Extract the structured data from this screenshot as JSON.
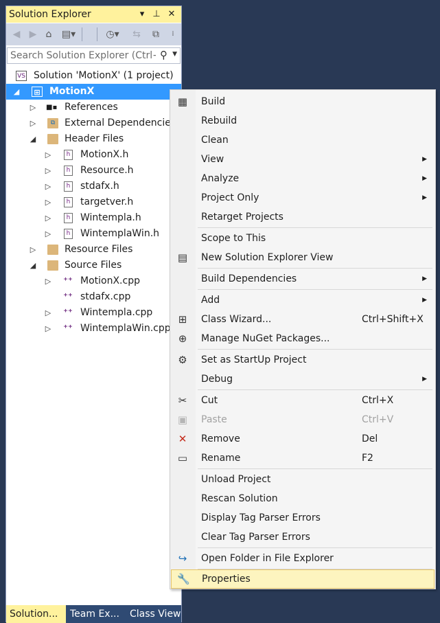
{
  "panel": {
    "title": "Solution Explorer",
    "title_controls": {
      "dropdown": "▾",
      "pin": "⊥",
      "close": "✕"
    },
    "search_placeholder": "Search Solution Explorer (Ctrl+;)",
    "colors": {
      "title_bg": "#fff29d",
      "selection": "#3399ff",
      "toolbar": "#cfd6e5",
      "background": "#293955"
    }
  },
  "tree": [
    {
      "label": "Solution 'MotionX' (1 project)",
      "icon": "solution-icon",
      "expander": ""
    },
    {
      "label": "MotionX",
      "icon": "project-icon",
      "expander": "◢",
      "selected": true
    },
    {
      "label": "References",
      "icon": "references-icon",
      "expander": "▷"
    },
    {
      "label": "External Dependencies",
      "icon": "external-deps-icon",
      "expander": "▷"
    },
    {
      "label": "Header Files",
      "icon": "folder-icon",
      "expander": "◢"
    },
    {
      "label": "MotionX.h",
      "icon": "header-file-icon",
      "expander": "▷"
    },
    {
      "label": "Resource.h",
      "icon": "header-file-icon",
      "expander": "▷"
    },
    {
      "label": "stdafx.h",
      "icon": "header-file-icon",
      "expander": "▷"
    },
    {
      "label": "targetver.h",
      "icon": "header-file-icon",
      "expander": "▷"
    },
    {
      "label": "Wintempla.h",
      "icon": "header-file-icon",
      "expander": "▷"
    },
    {
      "label": "WintemplaWin.h",
      "icon": "header-file-icon",
      "expander": "▷"
    },
    {
      "label": "Resource Files",
      "icon": "folder-icon",
      "expander": "▷"
    },
    {
      "label": "Source Files",
      "icon": "folder-icon",
      "expander": "◢"
    },
    {
      "label": "MotionX.cpp",
      "icon": "cpp-file-icon",
      "expander": "▷"
    },
    {
      "label": "stdafx.cpp",
      "icon": "cpp-file-icon",
      "expander": ""
    },
    {
      "label": "Wintempla.cpp",
      "icon": "cpp-file-icon",
      "expander": "▷"
    },
    {
      "label": "WintemplaWin.cpp",
      "icon": "cpp-file-icon",
      "expander": "▷"
    }
  ],
  "bottom_tabs": [
    {
      "label": "Solution...",
      "active": true
    },
    {
      "label": "Team Ex...",
      "active": false
    },
    {
      "label": "Class View",
      "active": false
    }
  ],
  "context_menu": {
    "items": [
      {
        "label": "Build",
        "icon": "build-icon",
        "glyph": "▦"
      },
      {
        "label": "Rebuild"
      },
      {
        "label": "Clean"
      },
      {
        "label": "View",
        "submenu": true
      },
      {
        "label": "Analyze",
        "submenu": true
      },
      {
        "label": "Project Only",
        "submenu": true
      },
      {
        "label": "Retarget Projects"
      },
      {
        "label": "Scope to This"
      },
      {
        "label": "New Solution Explorer View",
        "icon": "new-view-icon",
        "glyph": "▤"
      },
      {
        "label": "Build Dependencies",
        "submenu": true
      },
      {
        "label": "Add",
        "submenu": true
      },
      {
        "label": "Class Wizard...",
        "shortcut": "Ctrl+Shift+X",
        "icon": "class-wizard-icon",
        "glyph": "⊞"
      },
      {
        "label": "Manage NuGet Packages...",
        "icon": "nuget-icon",
        "glyph": "⊕"
      },
      {
        "label": "Set as StartUp Project",
        "icon": "gear-icon",
        "glyph": "⚙"
      },
      {
        "label": "Debug",
        "submenu": true
      },
      {
        "label": "Cut",
        "shortcut": "Ctrl+X",
        "icon": "scissors-icon",
        "glyph": "✂"
      },
      {
        "label": "Paste",
        "shortcut": "Ctrl+V",
        "icon": "paste-icon",
        "glyph": "▣",
        "disabled": true
      },
      {
        "label": "Remove",
        "shortcut": "Del",
        "icon": "remove-icon",
        "glyph": "✕"
      },
      {
        "label": "Rename",
        "shortcut": "F2",
        "icon": "rename-icon",
        "glyph": "▭"
      },
      {
        "label": "Unload Project"
      },
      {
        "label": "Rescan Solution"
      },
      {
        "label": "Display Tag Parser Errors"
      },
      {
        "label": "Clear Tag Parser Errors"
      },
      {
        "label": "Open Folder in File Explorer",
        "icon": "open-folder-icon",
        "glyph": "↪"
      },
      {
        "label": "Properties",
        "icon": "wrench-icon",
        "glyph": "🔧",
        "highlighted": true
      }
    ]
  }
}
